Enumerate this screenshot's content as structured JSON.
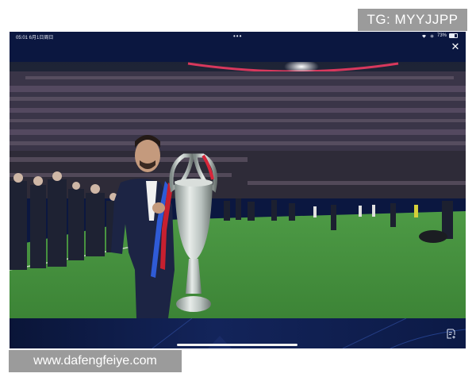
{
  "watermark_top": "TG: MYYJJPP",
  "watermark_bottom": "www.dafengfeiye.com",
  "status_bar": {
    "time_date": "05:01  6月1日周日",
    "center_dots": "•••",
    "battery_percent": "73%"
  },
  "controls": {
    "close_icon": "close-icon",
    "bottom_right_icon": "document-add-icon"
  },
  "colors": {
    "device_bg": "#0b1740",
    "pitch_green": "#3f8a3a",
    "stadium_ring": "#d8385d"
  }
}
